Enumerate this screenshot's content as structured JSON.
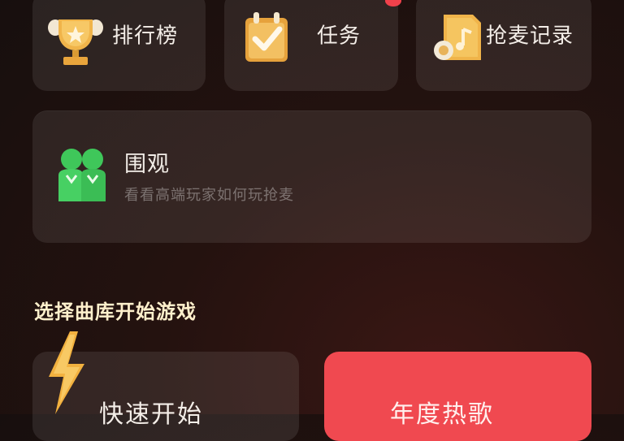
{
  "menu": {
    "ranking_label": "排行榜",
    "tasks_label": "任务",
    "records_label": "抢麦记录"
  },
  "spectate": {
    "title": "围观",
    "subtitle": "看看高端玩家如何玩抢麦"
  },
  "section": {
    "title": "选择曲库开始游戏"
  },
  "start": {
    "quick_label": "快速开始",
    "annual_label": "年度热歌"
  },
  "colors": {
    "accent_red": "#f04950",
    "card_bg": "rgba(255,255,255,0.085)",
    "gold": "#f0b44a",
    "green": "#3fc75a"
  },
  "icons": [
    "trophy-icon",
    "task-checklist-icon",
    "music-record-icon",
    "spectators-icon",
    "lightning-icon"
  ]
}
